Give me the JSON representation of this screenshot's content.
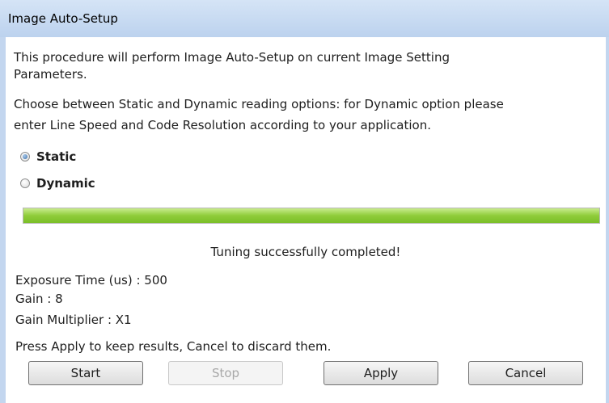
{
  "window": {
    "title": "Image Auto-Setup"
  },
  "description": {
    "line1": "This procedure will perform Image Auto-Setup on current Image Setting",
    "line2": "Parameters.",
    "line3": "Choose between Static and Dynamic reading options: for Dynamic option please",
    "line4": "enter Line Speed and Code Resolution according to your application."
  },
  "options": {
    "static_label": "Static",
    "dynamic_label": "Dynamic",
    "selected": "Static"
  },
  "progress": {
    "value": 1.0,
    "status": "Tuning successfully completed!"
  },
  "results": {
    "exposure": "Exposure Time (us) :  500",
    "gain": "Gain :  8",
    "gain_multiplier": "Gain Multiplier :  X1"
  },
  "instruction": "Press Apply to keep results, Cancel to discard them.",
  "buttons": {
    "start": "Start",
    "stop": "Stop",
    "apply": "Apply",
    "cancel": "Cancel"
  },
  "colors": {
    "progress_fill": "#8fcc3a",
    "titlebar": "#c8dbf2"
  }
}
